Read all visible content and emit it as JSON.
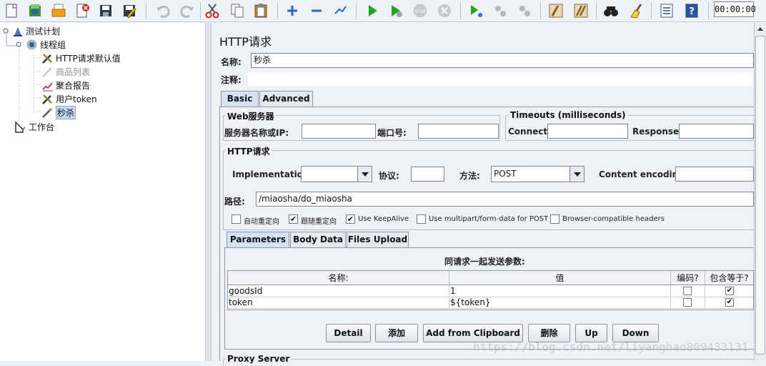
{
  "toolbar": {
    "icons": [
      "new-icon",
      "templates-icon",
      "open-icon",
      "close-icon",
      "save-icon",
      "save-as-icon",
      "undo-icon",
      "redo-icon",
      "cut-icon",
      "copy-icon",
      "paste-icon",
      "expand-icon",
      "collapse-icon",
      "toggle-icon",
      "start-icon",
      "start-no-pause-icon",
      "stop-icon",
      "shutdown-icon",
      "remote-start-icon",
      "remote-stop-icon",
      "remote-exit-icon",
      "clear-icon",
      "clear-all-icon",
      "search-icon",
      "reset-search-icon",
      "function-helper-icon",
      "help-icon"
    ],
    "timer": "00:00:00"
  },
  "tree": {
    "items": [
      {
        "label": "测试计划"
      },
      {
        "label": "线程组"
      },
      {
        "label": "HTTP请求默认值"
      },
      {
        "label": "商品列表"
      },
      {
        "label": "聚合报告"
      },
      {
        "label": "用户token"
      },
      {
        "label": "秒杀"
      },
      {
        "label": "工作台"
      }
    ]
  },
  "panel": {
    "title": "HTTP请求",
    "name_label": "名称:",
    "name_value": "秒杀",
    "comment_label": "注释:",
    "comment_value": "",
    "tabs": [
      "Basic",
      "Advanced"
    ],
    "web_server": {
      "legend": "Web服务器",
      "server_label": "服务器名称或IP:",
      "server_value": "",
      "port_label": "端口号:",
      "port_value": ""
    },
    "timeouts": {
      "legend": "Timeouts (milliseconds)",
      "connect_label": "Connect:",
      "connect_value": "",
      "response_label": "Response:",
      "response_value": ""
    },
    "http_request": {
      "legend": "HTTP请求",
      "implementation_label": "Implementation:",
      "implementation_value": "",
      "protocol_label": "协议:",
      "protocol_value": "",
      "method_label": "方法:",
      "method_value": "POST",
      "encoding_label": "Content encoding:",
      "encoding_value": "",
      "path_label": "路径:",
      "path_value": "/miaosha/do_miaosha"
    },
    "options": [
      {
        "label": "自动重定向",
        "checked": false
      },
      {
        "label": "跟随重定向",
        "checked": true
      },
      {
        "label": "Use KeepAlive",
        "checked": true
      },
      {
        "label": "Use multipart/form-data for POST",
        "checked": false
      },
      {
        "label": "Browser-compatible headers",
        "checked": false
      }
    ],
    "sub_tabs": [
      "Parameters",
      "Body Data",
      "Files Upload"
    ],
    "params_caption": "同请求一起发送参数:",
    "table": {
      "columns": [
        "名称:",
        "值",
        "编码?",
        "包含等于?"
      ],
      "rows": [
        {
          "name": "goodsId",
          "value": "1",
          "encode": false,
          "include_equals": true
        },
        {
          "name": "token",
          "value": "${token}",
          "encode": false,
          "include_equals": true
        }
      ]
    },
    "buttons": [
      "Detail",
      "添加",
      "Add from Clipboard",
      "删除",
      "Up",
      "Down"
    ],
    "proxy_legend": "Proxy Server"
  },
  "watermark": "https://blog.csdn.net/liyanghao809433131",
  "colors": {
    "selection": "#c6d7f2",
    "tab_selected": "#d5e2f4",
    "green_play": "#27a325"
  }
}
